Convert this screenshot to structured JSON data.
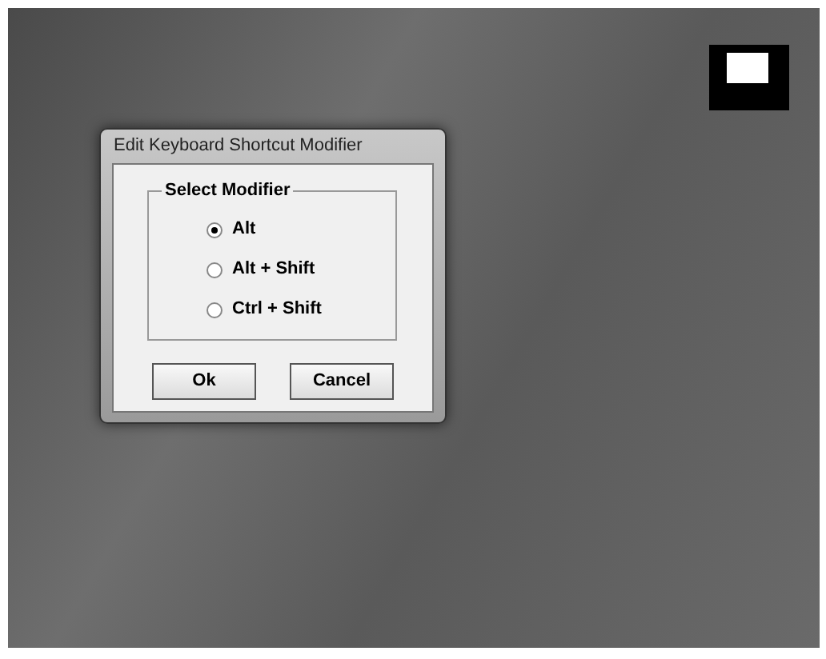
{
  "window": {
    "title": "Edit Keyboard Shortcut Modifier"
  },
  "group": {
    "title": "Select Modifier"
  },
  "options": [
    {
      "label": "Alt",
      "selected": true
    },
    {
      "label": "Alt + Shift",
      "selected": false
    },
    {
      "label": "Ctrl + Shift",
      "selected": false
    }
  ],
  "buttons": [
    "Ok",
    "Cancel"
  ]
}
